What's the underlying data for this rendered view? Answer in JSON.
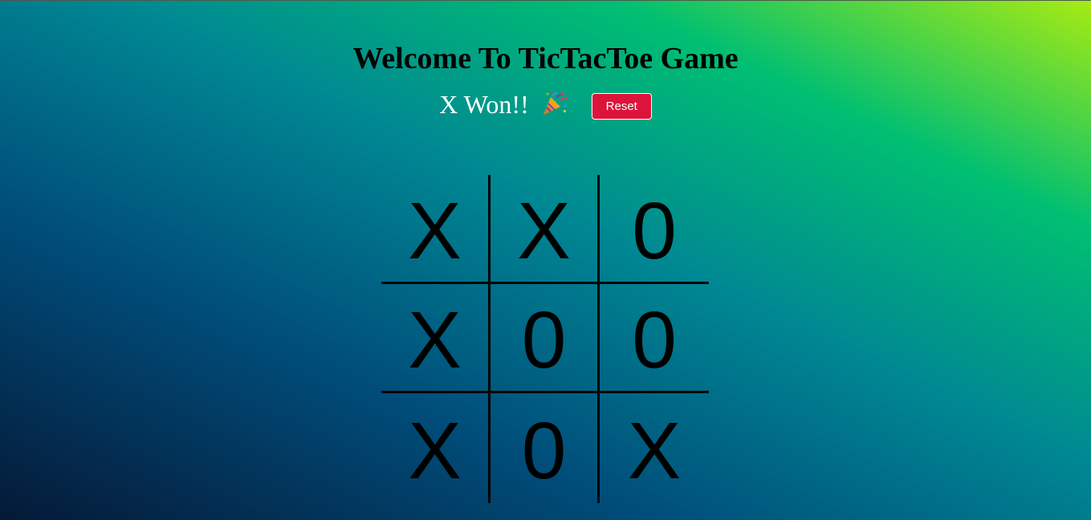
{
  "title": "Welcome To TicTacToe Game",
  "status": {
    "text": "X Won!!",
    "icon": "party-popper-icon"
  },
  "reset_label": "Reset",
  "colors": {
    "reset_bg": "#dc143c",
    "status_text": "#ffffff",
    "gradient": [
      "#051937",
      "#004d7a",
      "#008793",
      "#00bf72",
      "#a8eb12"
    ]
  },
  "board": {
    "cells": [
      "X",
      "X",
      "0",
      "X",
      "0",
      "0",
      "X",
      "0",
      "X"
    ]
  }
}
